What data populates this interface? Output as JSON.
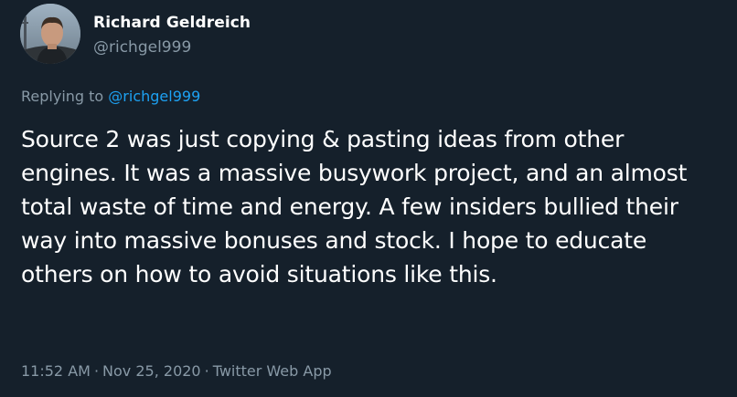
{
  "author": {
    "name": "Richard Geldreich",
    "handle": "@richgel999",
    "avatar_icon": "person-photo-avatar"
  },
  "reply": {
    "prefix": "Replying to",
    "target": "@richgel999"
  },
  "tweet": {
    "text": "Source 2 was just copying & pasting ideas from other engines. It was a massive busywork project, and an almost total waste of time and energy. A few insiders bullied their way into massive bonuses and stock. I hope to educate others on how to avoid situations like this."
  },
  "meta": {
    "time": "11:52 AM",
    "separator": "·",
    "date": "Nov 25, 2020",
    "source": "Twitter Web App"
  },
  "colors": {
    "background": "#15202b",
    "primary_text": "#ffffff",
    "secondary_text": "#8899a6",
    "link": "#1da1f2"
  }
}
